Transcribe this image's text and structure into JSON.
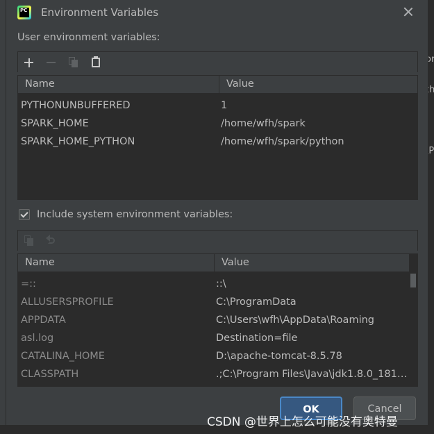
{
  "window": {
    "title": "Environment Variables"
  },
  "user_section": {
    "label": "User environment variables:"
  },
  "user_table": {
    "columns": [
      "Name",
      "Value"
    ],
    "rows": [
      {
        "name": "PYTHONUNBUFFERED",
        "value": "1"
      },
      {
        "name": "SPARK_HOME",
        "value": "/home/wfh/spark"
      },
      {
        "name": "SPARK_HOME_PYTHON",
        "value": "/home/wfh/spark/python"
      }
    ]
  },
  "system_section": {
    "label": "Include system environment variables:",
    "checked": true
  },
  "system_table": {
    "columns": [
      "Name",
      "Value"
    ],
    "rows": [
      {
        "name": "=::",
        "value": "::\\"
      },
      {
        "name": "ALLUSERSPROFILE",
        "value": "C:\\ProgramData"
      },
      {
        "name": "APPDATA",
        "value": "C:\\Users\\wfh\\AppData\\Roaming"
      },
      {
        "name": "asl.log",
        "value": "Destination=file"
      },
      {
        "name": "CATALINA_HOME",
        "value": "D:\\apache-tomcat-8.5.78"
      },
      {
        "name": "CLASSPATH",
        "value": ".;C:\\Program Files\\Java\\jdk1.8.0_181\\..."
      }
    ]
  },
  "buttons": {
    "ok": "OK",
    "cancel": "Cancel"
  },
  "watermark": "CSDN @世界上怎么可能没有奥特曼",
  "background_fragments": [
    "or",
    "th",
    "\\P"
  ],
  "colors": {
    "dialog_bg": "#3c3f41",
    "table_bg": "#2b2b2b",
    "ok_bg": "#365880",
    "ok_border": "#4a88c7",
    "text": "#bbbbbb",
    "muted_text": "#8a8a8a"
  },
  "icons": [
    "pycharm-logo-icon",
    "close-icon",
    "add-icon",
    "remove-icon",
    "copy-icon",
    "paste-icon",
    "checkbox-checked-icon",
    "undo-icon"
  ]
}
